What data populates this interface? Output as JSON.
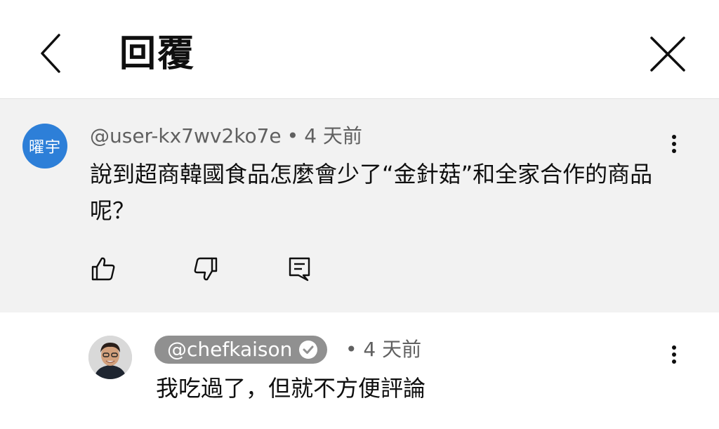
{
  "header": {
    "title": "回覆"
  },
  "parent_comment": {
    "avatar_text": "曜宇",
    "avatar_color": "#2d7fd8",
    "author": "@user-kx7wv2ko7e",
    "separator": "•",
    "time": "4 天前",
    "text": "說到超商韓國食品怎麼會少了“金針菇”和全家合作的商品呢？"
  },
  "reply": {
    "author": "@chefkaison",
    "separator": "•",
    "time": "4 天前",
    "text": "我吃過了，但就不方便評論"
  },
  "icons": [
    "back-icon",
    "close-icon",
    "more-vert-icon",
    "thumbs-up-icon",
    "thumbs-down-icon",
    "reply-icon",
    "verified-icon"
  ],
  "colors": {
    "parent_background": "#f2f2f2",
    "pill_background": "#909090",
    "secondary_text": "#606060"
  }
}
